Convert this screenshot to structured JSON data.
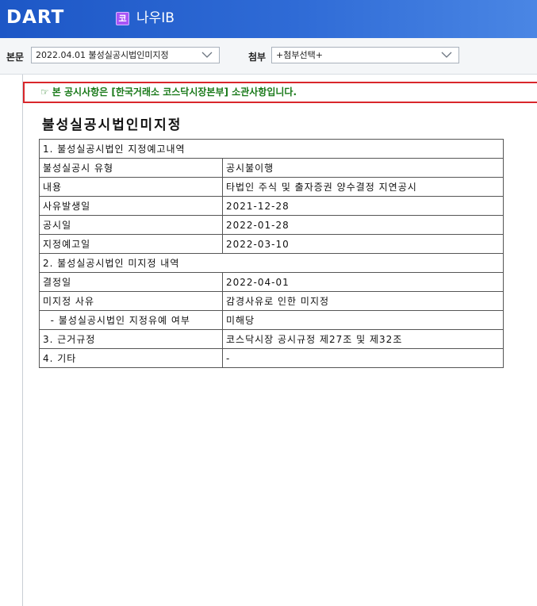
{
  "header": {
    "logo_text": "DART",
    "company_badge": "코",
    "company_name": "나우IB"
  },
  "toolbar": {
    "main_label": "본문",
    "main_selected": "2022.04.01  불성실공시법인미지정",
    "attach_label": "첨부",
    "attach_selected": "+첨부선택+"
  },
  "notice": {
    "hand": "☞",
    "text": "본 공시사항은 [한국거래소 코스닥시장본부] 소관사항입니다."
  },
  "document": {
    "title": "불성실공시법인미지정",
    "rows": [
      {
        "type": "section",
        "label": "1. 불성실공시법인 지정예고내역"
      },
      {
        "type": "pair",
        "label": "불성실공시 유형",
        "value": "공시불이행"
      },
      {
        "type": "pair",
        "label": "내용",
        "value": "타법인 주식 및 출자증권 양수결정 지연공시"
      },
      {
        "type": "pair",
        "label": "사유발생일",
        "value": "2021-12-28"
      },
      {
        "type": "pair",
        "label": "공시일",
        "value": "2022-01-28"
      },
      {
        "type": "pair",
        "label": "지정예고일",
        "value": "2022-03-10"
      },
      {
        "type": "section",
        "label": "2. 불성실공시법인 미지정 내역"
      },
      {
        "type": "pair",
        "label": "결정일",
        "value": "2022-04-01"
      },
      {
        "type": "pair",
        "label": "미지정 사유",
        "value": "감경사유로 인한 미지정"
      },
      {
        "type": "pair",
        "label": "  - 불성실공시법인 지정유예 여부",
        "value": "미해당"
      },
      {
        "type": "pair",
        "label": "3. 근거규정",
        "value": "코스닥시장 공시규정 제27조 및 제32조"
      },
      {
        "type": "pair",
        "label": "4. 기타",
        "value": "-"
      }
    ]
  }
}
